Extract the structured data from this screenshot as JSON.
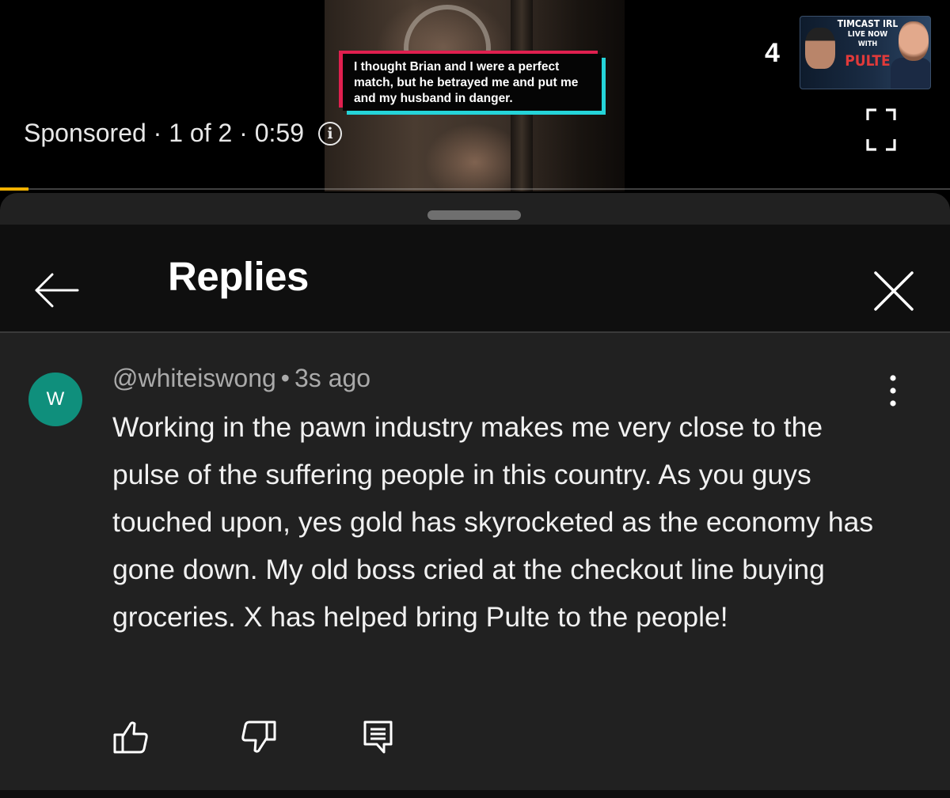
{
  "video": {
    "caption": "I thought Brian and I were a perfect match, but he betrayed me and put me and my husband in danger.",
    "ad_status": "Sponsored · 1 of 2 · 0:59",
    "count": "4",
    "promo": {
      "line1": "TIMCAST IRL",
      "line2": "LIVE NOW",
      "line3": "WITH",
      "line4": "PULTE"
    },
    "progress_fraction": 0.03,
    "colors": {
      "progress": "#f2b100",
      "caption_pink": "#e01f4f",
      "caption_cyan": "#25d4d9"
    }
  },
  "replies": {
    "title": "Replies",
    "comment": {
      "avatar_letter": "W",
      "avatar_color": "#0f8f7c",
      "author": "@whiteiswong",
      "separator": "•",
      "time": "3s ago",
      "text": "Working in the pawn industry makes me very close to the pulse of the suffering people in this country. As you guys touched upon, yes gold has skyrocketed as the economy has gone down. My old boss cried at the checkout line buying groceries. X has helped bring Pulte to the people!"
    },
    "icons": [
      "back-arrow-icon",
      "close-icon",
      "more-vert-icon",
      "thumbs-up-icon",
      "thumbs-down-icon",
      "reply-icon"
    ]
  }
}
